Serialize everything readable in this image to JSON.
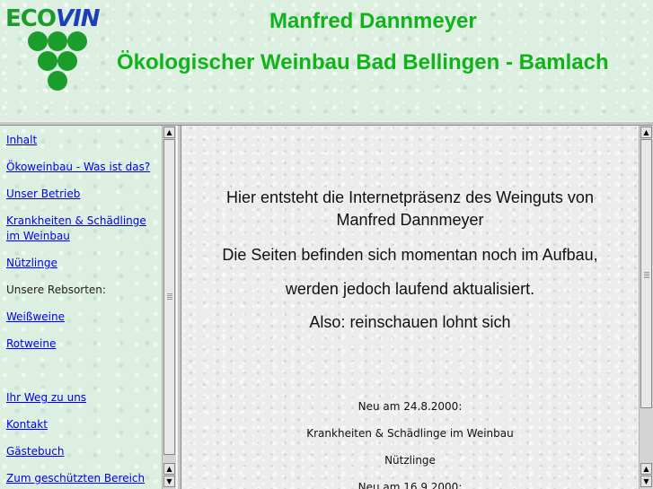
{
  "header": {
    "logo": {
      "eco": "ECO",
      "vin": "VIN"
    },
    "owner_name": "Manfred Dannmeyer",
    "tagline": "Ökologischer Weinbau Bad Bellingen - Bamlach"
  },
  "nav": {
    "items": [
      {
        "label": "Inhalt",
        "link": true
      },
      {
        "label": "Ökoweinbau - Was ist das?",
        "link": true
      },
      {
        "label": "Unser Betrieb",
        "link": true
      },
      {
        "label": "Krankheiten & Schädlinge im Weinbau",
        "link": true
      },
      {
        "label": "Nützlinge",
        "link": true
      },
      {
        "label": "Unsere Rebsorten:",
        "link": false
      },
      {
        "label": "Weißweine",
        "link": true
      },
      {
        "label": "Rotweine",
        "link": true
      },
      {
        "label": "Ihr Weg zu uns",
        "link": true
      },
      {
        "label": "Kontakt",
        "link": true
      },
      {
        "label": "Gästebuch",
        "link": true
      },
      {
        "label": "Zum geschützten Bereich",
        "link": true
      }
    ]
  },
  "content": {
    "intro_line1": "Hier entsteht die Internetpräsenz des Weinguts von",
    "intro_line2": "Manfred Dannmeyer",
    "status_line1": "Die Seiten befinden sich momentan noch im Aufbau,",
    "status_line2": "werden jedoch laufend aktualisiert.",
    "invite": "Also: reinschauen lohnt sich",
    "news": [
      "Neu am 24.8.2000:",
      "Krankheiten & Schädlinge im Weinbau",
      "Nützlinge",
      "Neu am 16.9.2000:"
    ]
  },
  "colors": {
    "title_green": "#10b31a",
    "logo_green": "#1a9d2a",
    "logo_blue": "#1c3fb8",
    "link_blue": "#0000ee",
    "frame_bg": "#dcefe0"
  }
}
